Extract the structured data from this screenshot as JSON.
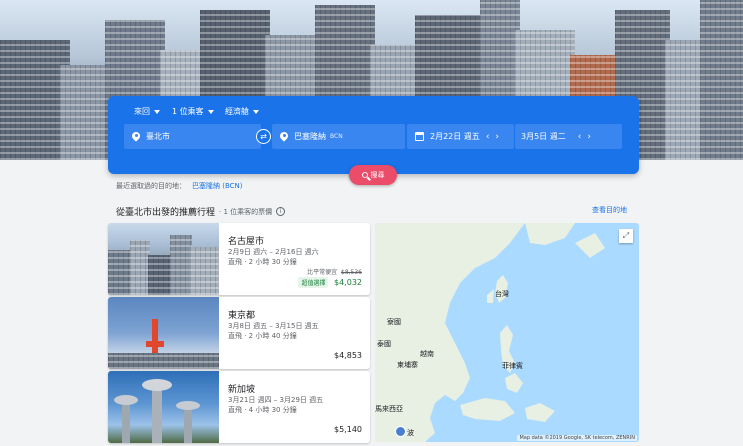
{
  "search": {
    "trip_type": "來回",
    "passengers": "1 位乘客",
    "cabin": "經濟艙",
    "origin": "臺北市",
    "destination": "巴塞隆納",
    "destination_code": "BCN",
    "depart_date": "2月22日 週五",
    "return_date": "3月5日 週二",
    "search_label": "搜尋"
  },
  "recent": {
    "label": "最近選取過的目的地：",
    "item": "巴塞隆納 (BCN)"
  },
  "section": {
    "title": "從臺北市出發的推薦行程",
    "subtitle": "· 1 位乘客的票價",
    "view_all": "查看目的地"
  },
  "trips": [
    {
      "city": "名古屋市",
      "dates": "2月9日 週六 – 2月16日 週六",
      "duration": "直飛 · 2 小時 30 分鐘",
      "usual_label": "比平常便宜",
      "usual_price": "$8,536",
      "badge": "超值選擇",
      "price": "$4,032"
    },
    {
      "city": "東京都",
      "dates": "3月8日 週五 – 3月15日 週五",
      "duration": "直飛 · 2 小時 40 分鐘",
      "price": "$4,853"
    },
    {
      "city": "新加坡",
      "dates": "3月21日 週四 – 3月29日 週五",
      "duration": "直飛 · 4 小時 30 分鐘",
      "price": "$5,140"
    }
  ],
  "map": {
    "labels": {
      "taiwan": "台灣",
      "laos": "寮國",
      "thailand": "泰國",
      "vietnam": "越南",
      "cambodia": "柬埔寨",
      "philippines": "菲律賓",
      "malaysia": "馬來西亞",
      "cut": "波"
    },
    "attribution": "Map data ©2019 Google, SK telecom, ZENRIN",
    "expand_icon": "fullscreen-icon"
  }
}
